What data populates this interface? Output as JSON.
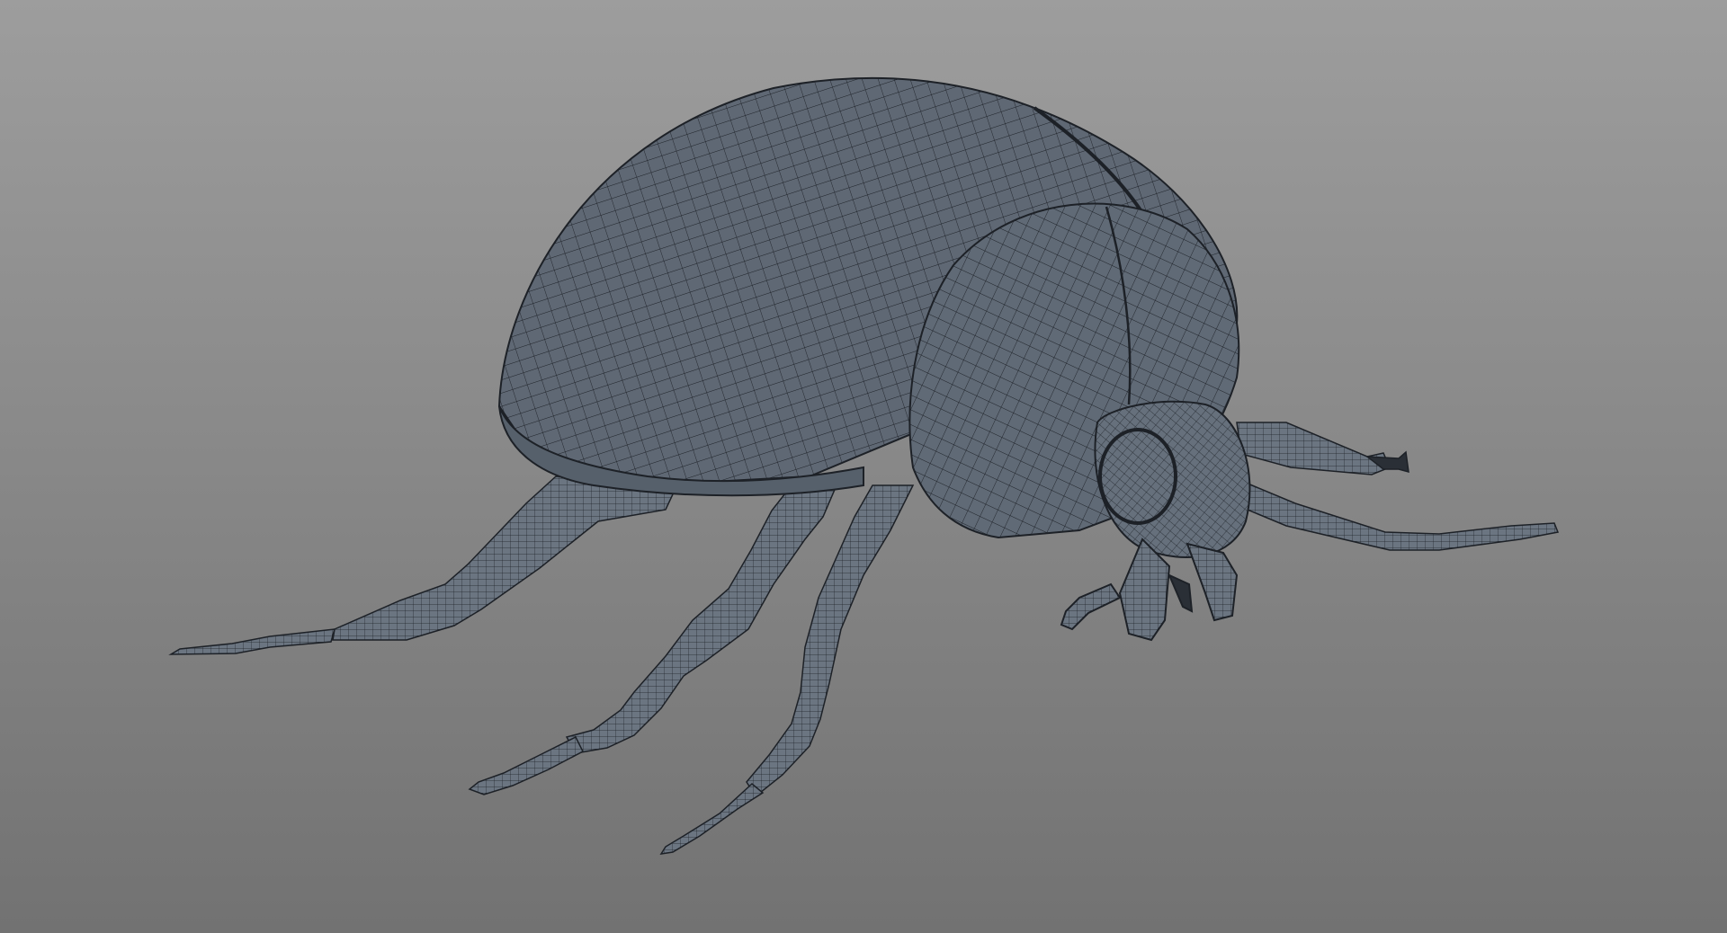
{
  "viewport": {
    "subject": "beetle",
    "display_mode": "wireframe-on-shaded",
    "colors": {
      "background_top": "#9d9d9d",
      "background_bottom": "#727272",
      "mesh_fill": "#5f6874",
      "mesh_fill_light": "#6b7581",
      "wire": "#1d2127"
    }
  }
}
